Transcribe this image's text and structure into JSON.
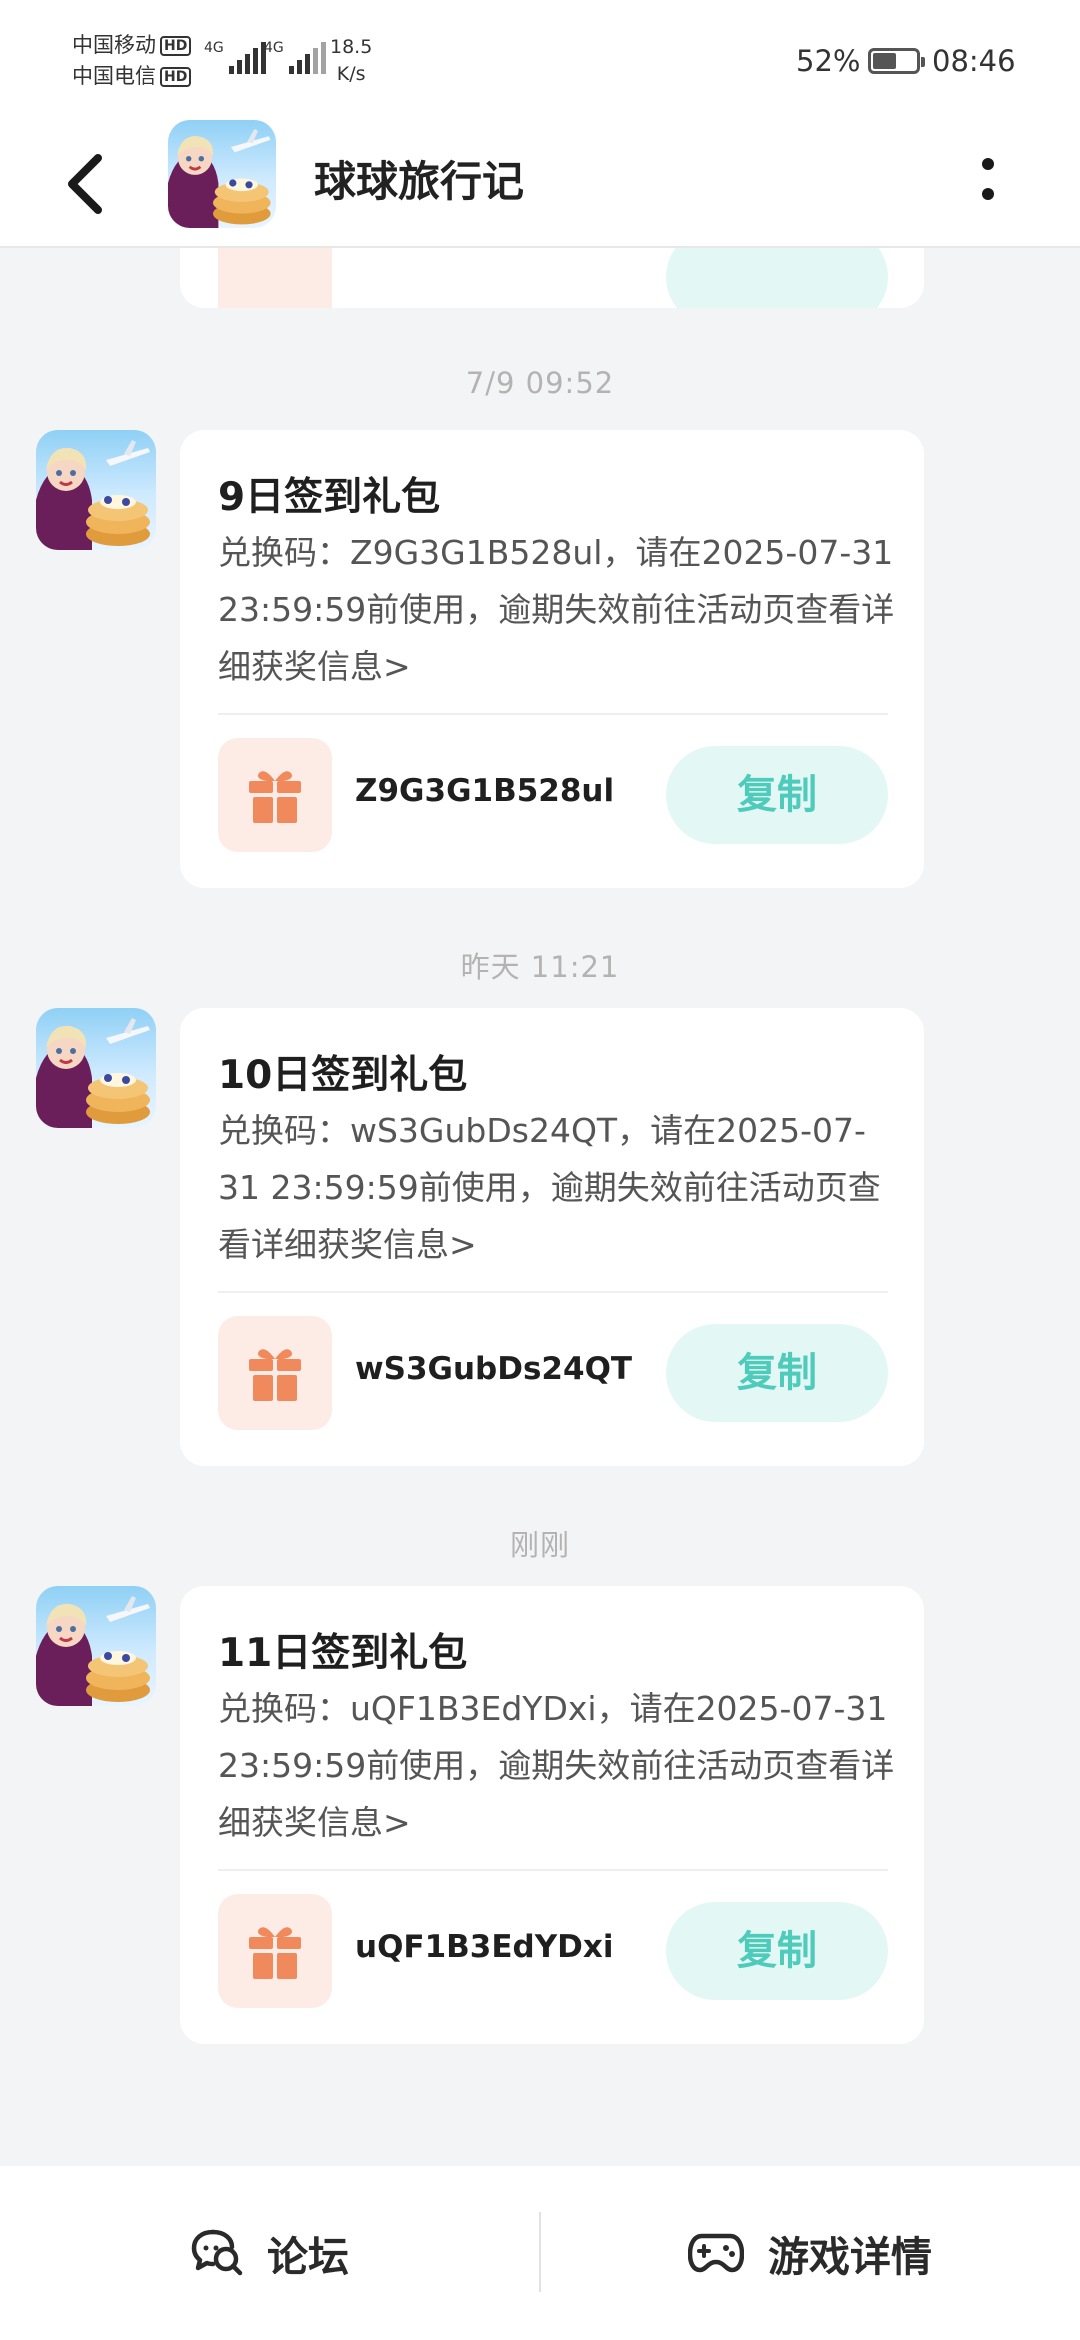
{
  "status_bar": {
    "carrier_1": "中国移动",
    "carrier_2": "中国电信",
    "hd": "HD",
    "net_type": "4G",
    "speed_value": "18.5",
    "speed_unit": "K/s",
    "battery": "52%",
    "battery_level": 0.52,
    "time": "08:46"
  },
  "header": {
    "title": "球球旅行记"
  },
  "messages": [
    {
      "time": "7/9   09:52",
      "title": "9日签到礼包",
      "body": "兑换码：Z9G3G1B528ul，请在2025-07-31 23:59:59前使用，逾期失效前往活动页查看详细获奖信息>",
      "code": "Z9G3G1B528ul",
      "copy_label": "复制"
    },
    {
      "time": "昨天   11:21",
      "title": "10日签到礼包",
      "body": "兑换码：wS3GubDs24QT，请在2025-07-31 23:59:59前使用，逾期失效前往活动页查看详细获奖信息>",
      "code": "wS3GubDs24QT",
      "copy_label": "复制"
    },
    {
      "time": "刚刚",
      "title": "11日签到礼包",
      "body": "兑换码：uQF1B3EdYDxi，请在2025-07-31 23:59:59前使用，逾期失效前往活动页查看详细获奖信息>",
      "code": "uQF1B3EdYDxi",
      "copy_label": "复制"
    }
  ],
  "bottom_bar": {
    "forum_label": "论坛",
    "game_detail_label": "游戏详情"
  },
  "colors": {
    "accent": "#4fcbbb",
    "gift": "#f08a5d",
    "gift_bg": "#fdebe6"
  },
  "icons": {
    "back": "chevron-left-icon",
    "more": "more-vertical-icon",
    "gift": "gift-icon",
    "forum": "chat-bubble-icon",
    "game": "gamepad-icon"
  }
}
